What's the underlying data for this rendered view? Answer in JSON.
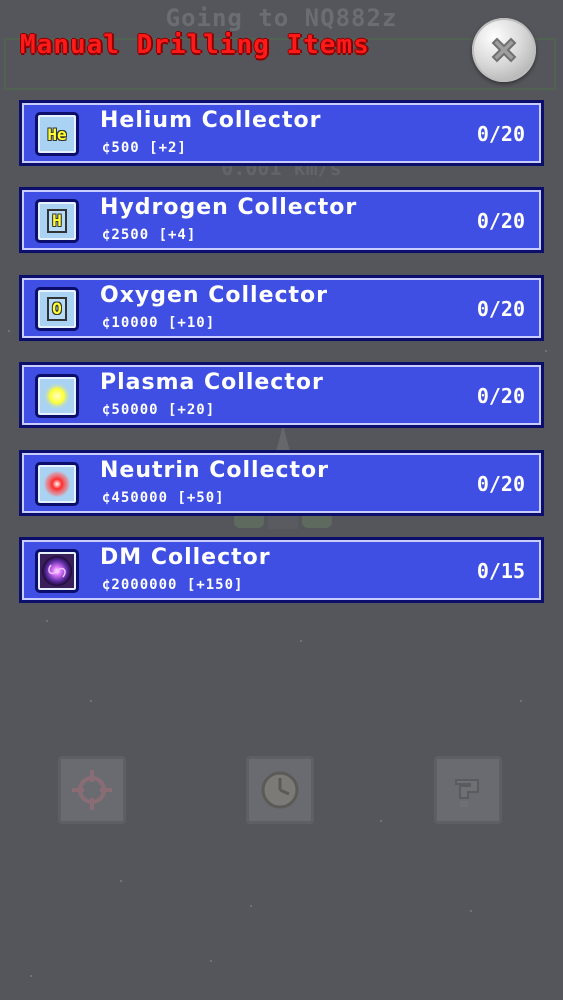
{
  "background": {
    "destination_text": "Going to NQ882z",
    "speed_text": "0.001 km/s",
    "buttons": [
      "target-icon",
      "clock-icon",
      "help-icon"
    ]
  },
  "panel": {
    "title": "Manual Drilling Items",
    "close_icon": "close-icon",
    "title_color": "#ff1a1a",
    "item_color": "#3f4fe3"
  },
  "items": [
    {
      "name": "Helium Collector",
      "price": "¢500 [+2]",
      "count": "0/20",
      "icon": "helium-icon",
      "symbol": "He"
    },
    {
      "name": "Hydrogen Collector",
      "price": "¢2500 [+4]",
      "count": "0/20",
      "icon": "hydrogen-icon",
      "symbol": "H"
    },
    {
      "name": "Oxygen Collector",
      "price": "¢10000 [+10]",
      "count": "0/20",
      "icon": "oxygen-icon",
      "symbol": "O"
    },
    {
      "name": "Plasma Collector",
      "price": "¢50000 [+20]",
      "count": "0/20",
      "icon": "plasma-orb-icon"
    },
    {
      "name": "Neutrin Collector",
      "price": "¢450000 [+50]",
      "count": "0/20",
      "icon": "neutrino-orb-icon"
    },
    {
      "name": "DM Collector",
      "price": "¢2000000 [+150]",
      "count": "0/15",
      "icon": "dark-matter-galaxy-icon"
    }
  ]
}
